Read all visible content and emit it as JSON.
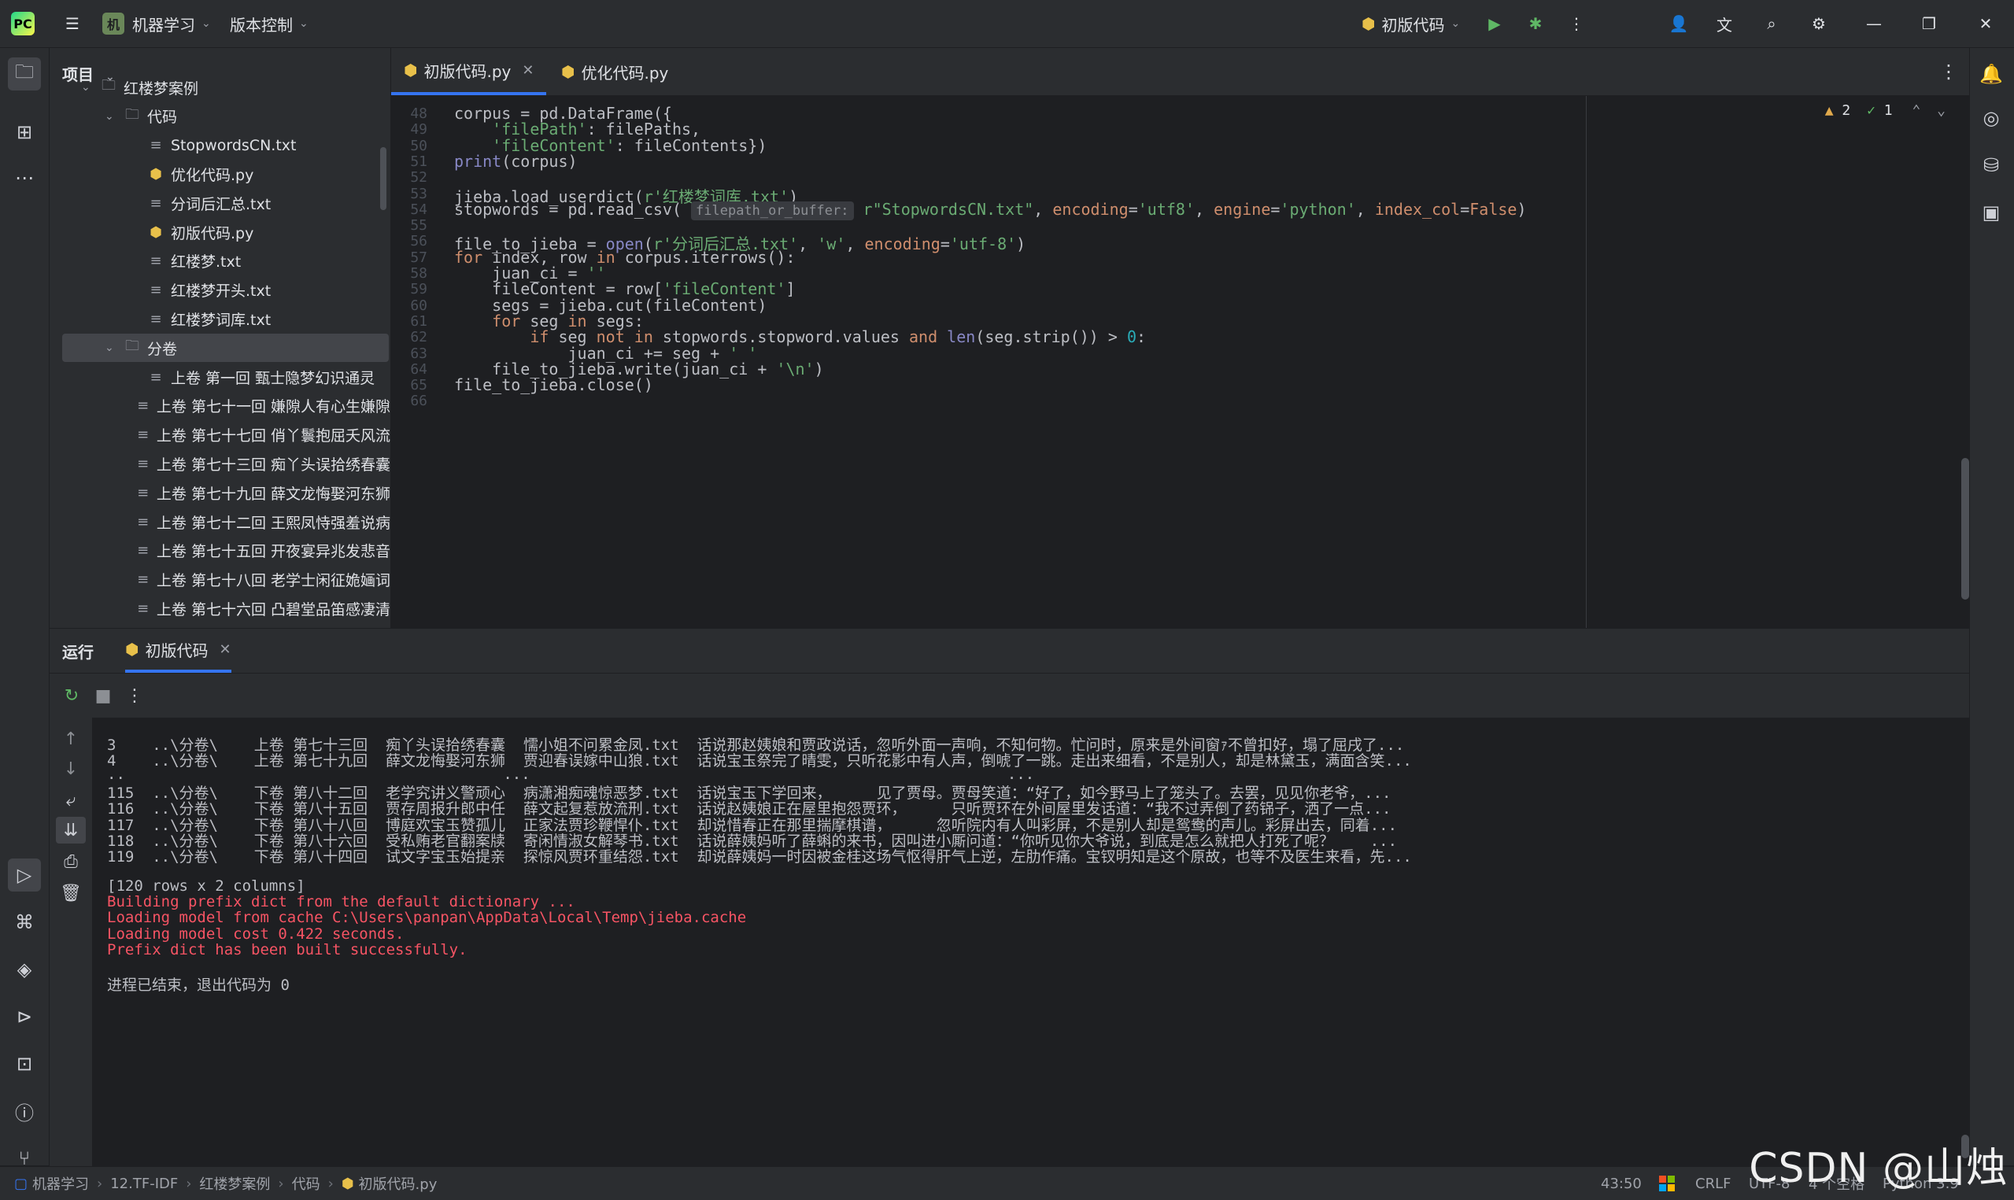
{
  "titlebar": {
    "project_name": "机器学习",
    "project_badge": "机",
    "vcs_label": "版本控制",
    "run_config": "初版代码"
  },
  "project_panel": {
    "header": "项目",
    "tree": [
      {
        "label": "红楼梦案例",
        "type": "folder",
        "level": 1,
        "expanded": true
      },
      {
        "label": "代码",
        "type": "folder",
        "level": 2,
        "expanded": true
      },
      {
        "label": "StopwordsCN.txt",
        "type": "txt",
        "level": 3
      },
      {
        "label": "优化代码.py",
        "type": "py",
        "level": 3
      },
      {
        "label": "分词后汇总.txt",
        "type": "txt",
        "level": 3
      },
      {
        "label": "初版代码.py",
        "type": "py",
        "level": 3
      },
      {
        "label": "红楼梦.txt",
        "type": "txt",
        "level": 3
      },
      {
        "label": "红楼梦开头.txt",
        "type": "txt",
        "level": 3
      },
      {
        "label": "红楼梦词库.txt",
        "type": "txt",
        "level": 3
      },
      {
        "label": "分卷",
        "type": "folder",
        "level": 2,
        "expanded": true,
        "selected": true
      },
      {
        "label": "上卷 第一回  甄士隐梦幻识通灵",
        "type": "txt",
        "level": 3
      },
      {
        "label": "上卷 第七十一回  嫌隙人有心生嫌隙",
        "type": "txt",
        "level": 3
      },
      {
        "label": "上卷 第七十七回  俏丫鬟抱屈夭风流",
        "type": "txt",
        "level": 3
      },
      {
        "label": "上卷 第七十三回  痴丫头误拾绣春囊",
        "type": "txt",
        "level": 3
      },
      {
        "label": "上卷 第七十九回  薛文龙悔娶河东狮",
        "type": "txt",
        "level": 3
      },
      {
        "label": "上卷 第七十二回  王熙凤恃强羞说病",
        "type": "txt",
        "level": 3
      },
      {
        "label": "上卷 第七十五回  开夜宴异兆发悲音",
        "type": "txt",
        "level": 3
      },
      {
        "label": "上卷 第七十八回  老学士闲征姽婳词",
        "type": "txt",
        "level": 3
      },
      {
        "label": "上卷 第七十六回  凸碧堂品笛感凄清",
        "type": "txt",
        "level": 3
      }
    ]
  },
  "tabs": [
    {
      "label": "初版代码.py",
      "active": true
    },
    {
      "label": "优化代码.py",
      "active": false
    }
  ],
  "editor": {
    "inspections": {
      "warnings": "2",
      "weak": "1"
    },
    "lines": [
      {
        "n": "48",
        "html": "corpus = pd.DataFrame({"
      },
      {
        "n": "49",
        "html": "    <span class='str'>'filePath'</span>: filePaths,"
      },
      {
        "n": "50",
        "html": "    <span class='str'>'fileContent'</span>: fileContents})"
      },
      {
        "n": "51",
        "html": "<span class='bi'>print</span>(corpus)"
      },
      {
        "n": "52",
        "html": ""
      },
      {
        "n": "53",
        "html": "jieba.load_userdict(<span class='str'>r'红楼梦词库.txt'</span>)"
      },
      {
        "n": "54",
        "html": "stopwords = pd.read_csv( <span class='hint'>filepath_or_buffer:</span> <span class='str'>r\"StopwordsCN.txt\"</span>, <span class='param'>encoding</span>=<span class='str'>'utf8'</span>, <span class='param'>engine</span>=<span class='str'>'python'</span>, <span class='param'>index_col</span>=<span class='kw'>False</span>)"
      },
      {
        "n": "55",
        "html": ""
      },
      {
        "n": "56",
        "html": "file_to_jieba = <span class='bi'>open</span>(<span class='str'>r'分词后汇总.txt'</span>, <span class='str'>'w'</span>, <span class='param'>encoding</span>=<span class='str'>'utf-8'</span>)"
      },
      {
        "n": "57",
        "html": "<span class='kw'>for</span> index, row <span class='kw'>in</span> corpus.iterrows():"
      },
      {
        "n": "58",
        "html": "    juan_ci = <span class='str'>''</span>"
      },
      {
        "n": "59",
        "html": "    fileContent = row[<span class='str'>'fileContent'</span>]"
      },
      {
        "n": "60",
        "html": "    segs = jieba.cut(fileContent)"
      },
      {
        "n": "61",
        "html": "    <span class='kw'>for</span> seg <span class='kw'>in</span> segs:"
      },
      {
        "n": "62",
        "html": "        <span class='kw'>if</span> seg <span class='kw'>not in</span> stopwords.stopword.values <span class='kw'>and</span> <span class='bi'>len</span>(seg.strip()) > <span class='num'>0</span>:"
      },
      {
        "n": "63",
        "html": "            juan_ci += seg + <span class='str'>' '</span>"
      },
      {
        "n": "64",
        "html": "    file_to_jieba.write(juan_ci + <span class='str'>'\\n'</span>)"
      },
      {
        "n": "65",
        "html": "file_to_jieba.close()"
      },
      {
        "n": "66",
        "html": ""
      }
    ]
  },
  "run_panel": {
    "title": "运行",
    "tab": "初版代码",
    "console": [
      {
        "text": "3    ..\\分卷\\    上卷 第七十三回  痴丫头误拾绣春囊  懦小姐不问累金凤.txt  话说那赵姨娘和贾政说话，忽听外面一声响，不知何物。忙问时，原来是外间窗ｧ不曾扣好，塌了屈戌了...",
        "cls": ""
      },
      {
        "text": "4    ..\\分卷\\    上卷 第七十九回  薛文龙悔娶河东狮  贾迎春误嫁中山狼.txt  话说宝玉祭完了晴雯，只听花影中有人声，倒唬了一跳。走出来细看，不是别人，却是林黛玉，满面含笑...",
        "cls": ""
      },
      {
        "text": "..                                          ...                                                     ...",
        "cls": ""
      },
      {
        "text": "115  ..\\分卷\\    下卷 第八十二回  老学究讲义警顽心  病潇湘痴魂惊恶梦.txt  话说宝玉下学回来，     见了贾母。贾母笑道：“好了，如今野马上了笼头了。去罢，见见你老爷，...",
        "cls": ""
      },
      {
        "text": "116  ..\\分卷\\    下卷 第八十五回  贾存周报升郎中任  薛文起复惹放流刑.txt  话说赵姨娘正在屋里抱怨贾环，     只听贾环在外间屋里发话道：“我不过弄倒了药铞子，洒了一点...",
        "cls": ""
      },
      {
        "text": "117  ..\\分卷\\    下卷 第八十八回  博庭欢宝玉赞孤儿  正家法贾珍鞭悍仆.txt  却说惜春正在那里揣摩棋谱，     忽听院内有人叫彩屏，不是别人却是鸳鸯的声儿。彩屏出去，同着...",
        "cls": ""
      },
      {
        "text": "118  ..\\分卷\\    下卷 第八十六回  受私贿老官翻案牍  寄闲情淑女解琴书.txt  话说薛姨妈听了薛蝌的来书，因叫进小厮问道：“你听见你大爷说，到底是怎么就把人打死了呢？    ...",
        "cls": ""
      },
      {
        "text": "119  ..\\分卷\\    下卷 第八十四回  试文字宝玉始提亲  探惊风贾环重结怨.txt  却说薛姨妈一时因被金桂这场气怄得肝气上逆，左肋作痛。宝钗明知是这个原故，也等不及医生来看，先...",
        "cls": ""
      },
      {
        "text": "",
        "cls": ""
      },
      {
        "text": "[120 rows x 2 columns]",
        "cls": ""
      },
      {
        "text": "Building prefix dict from the default dictionary ...",
        "cls": "err"
      },
      {
        "text": "Loading model from cache C:\\Users\\panpan\\AppData\\Local\\Temp\\jieba.cache",
        "cls": "err"
      },
      {
        "text": "Loading model cost 0.422 seconds.",
        "cls": "err"
      },
      {
        "text": "Prefix dict has been built successfully.",
        "cls": "err"
      },
      {
        "text": "",
        "cls": ""
      },
      {
        "text": "进程已结束，退出代码为 0",
        "cls": ""
      }
    ]
  },
  "statusbar": {
    "breadcrumb": [
      "机器学习",
      "12.TF-IDF",
      "红楼梦案例",
      "代码",
      "初版代码.py"
    ],
    "position": "43:50",
    "line_sep": "CRLF",
    "encoding": "UTF-8",
    "indent": "4 个空格",
    "interpreter": "Python 3.9"
  },
  "watermark": "CSDN @山烛",
  "colors": {
    "accent": "#3574f0",
    "error": "#f75464",
    "string": "#6aab73",
    "keyword": "#cf8e6d"
  }
}
